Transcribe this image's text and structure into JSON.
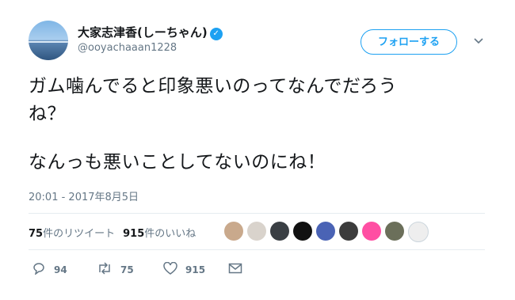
{
  "profile": {
    "display_name": "大家志津香(しーちゃん)",
    "handle": "@ooyachaaan1228",
    "verified_icon": "verified-badge-icon"
  },
  "follow_button": {
    "label": "フォローする"
  },
  "tweet": {
    "lines": [
      "ガム噛んでると印象悪いのってなんでだろう",
      "ね？",
      "なんっも悪いことしてないのにね！"
    ],
    "timestamp": "20:01 - 2017年8月5日"
  },
  "stats": {
    "retweets_count": "75",
    "retweets_label": "件のリツイート",
    "likes_count": "915",
    "likes_label": "件のいいね"
  },
  "likers_avatar_colors": [
    "#c9a98c",
    "#d9d3cc",
    "#3a3f44",
    "#111111",
    "#4a63b5",
    "#3c3c3c",
    "#ff4fa3",
    "#6b6f5a",
    "#eeeeee"
  ],
  "actions": {
    "reply_count": "94",
    "retweet_count": "75",
    "like_count": "915"
  },
  "colors": {
    "accent": "#1da1f2",
    "secondary_text": "#657786",
    "divider": "#e6ecf0"
  }
}
